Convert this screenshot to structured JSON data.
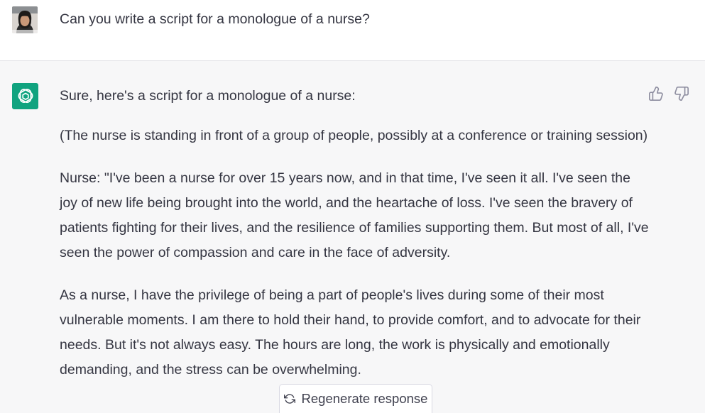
{
  "user_message": {
    "text": "Can you write a script for a monologue of a nurse?",
    "avatar": "user-photo-avatar"
  },
  "assistant_message": {
    "avatar": "openai-logo-icon",
    "paragraphs": [
      "Sure, here's a script for a monologue of a nurse:",
      "(The nurse is standing in front of a group of people, possibly at a conference or training session)",
      "Nurse: \"I've been a nurse for over 15 years now, and in that time, I've seen it all. I've seen the joy of new life being brought into the world, and the heartache of loss. I've seen the bravery of patients fighting for their lives, and the resilience of families supporting them. But most of all, I've seen the power of compassion and care in the face of adversity.",
      "As a nurse, I have the privilege of being a part of people's lives during some of their most vulnerable moments. I am there to hold their hand, to provide comfort, and to advocate for their needs. But it's not always easy. The hours are long, the work is physically and emotionally demanding, and the stress can be overwhelming."
    ]
  },
  "feedback": {
    "thumbs_up_icon": "thumbs-up-icon",
    "thumbs_down_icon": "thumbs-down-icon"
  },
  "regenerate": {
    "label": "Regenerate response",
    "icon": "refresh-icon"
  },
  "colors": {
    "accent": "#10a37f",
    "text": "#343541",
    "assistant_bg": "#f7f7f8"
  }
}
